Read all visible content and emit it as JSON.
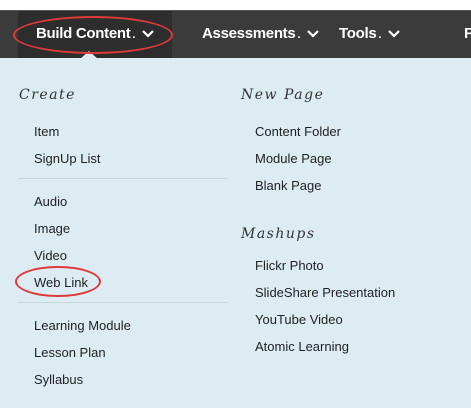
{
  "nav": {
    "items": [
      {
        "label": "Build Content",
        "suffix": "."
      },
      {
        "label": "Assessments",
        "suffix": "."
      },
      {
        "label": "Tools",
        "suffix": "."
      },
      {
        "label": "F",
        "suffix": ""
      }
    ]
  },
  "menu": {
    "create": {
      "title": "Create",
      "group1": [
        "Item",
        "SignUp List"
      ],
      "group2": [
        "Audio",
        "Image",
        "Video",
        "Web Link"
      ],
      "group3": [
        "Learning Module",
        "Lesson Plan",
        "Syllabus"
      ]
    },
    "new_page": {
      "title": "New Page",
      "items": [
        "Content Folder",
        "Module Page",
        "Blank Page"
      ]
    },
    "mashups": {
      "title": "Mashups",
      "items": [
        "Flickr Photo",
        "SlideShare Presentation",
        "YouTube Video",
        "Atomic Learning"
      ]
    }
  },
  "colors": {
    "nav_bg": "#3b3b3b",
    "panel_bg": "#dcecf2",
    "highlight": "#e0393b"
  },
  "icons": {
    "dropdown": "chevron-down-icon"
  }
}
